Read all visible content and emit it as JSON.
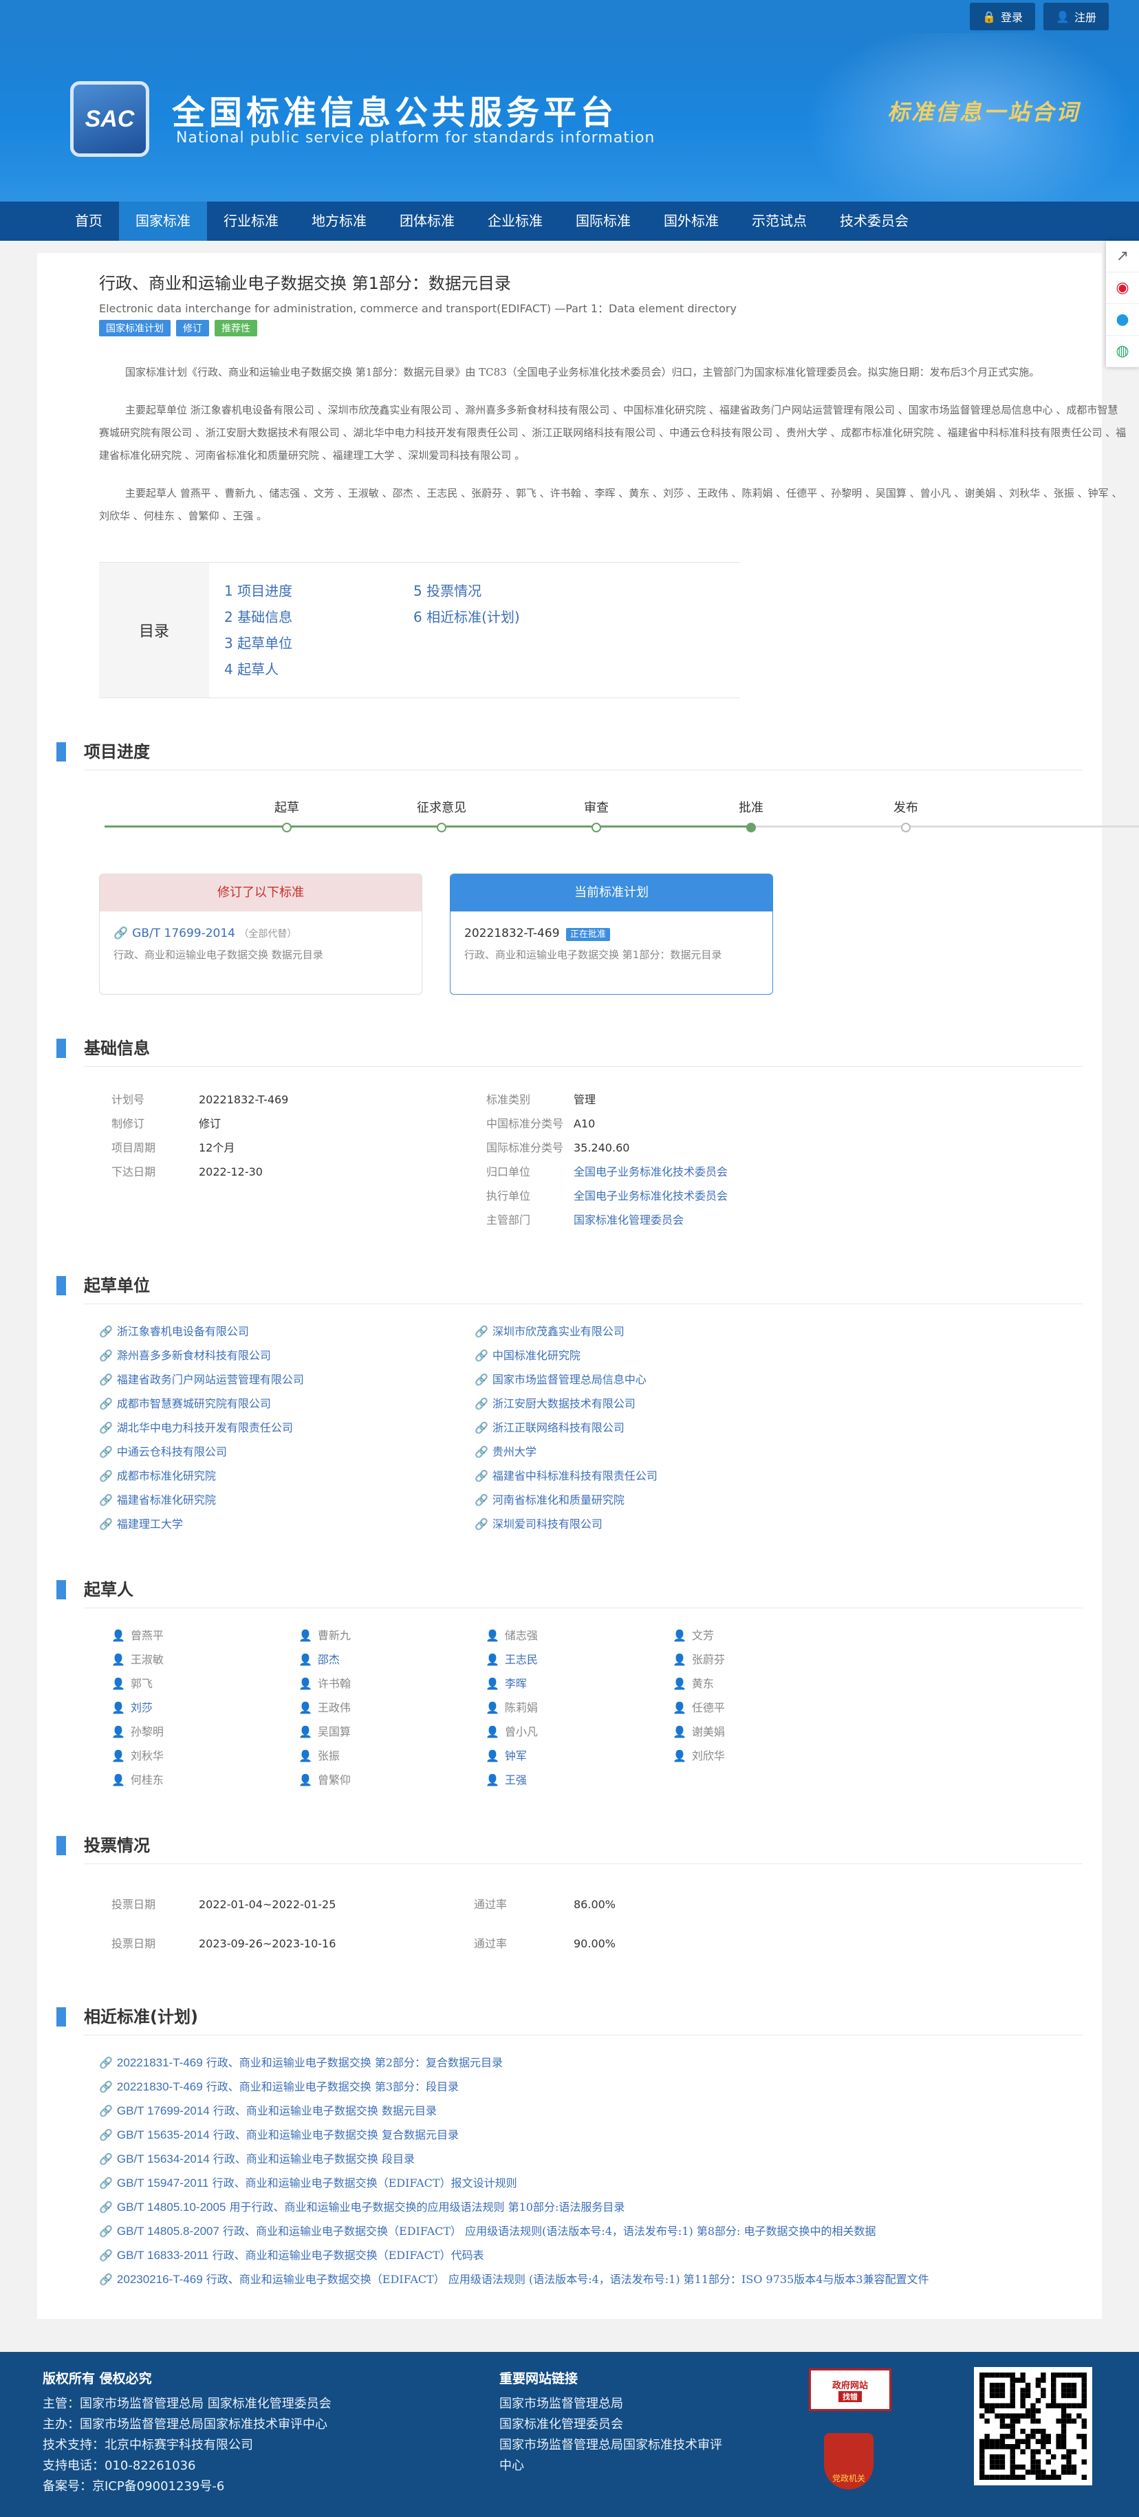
{
  "top": {
    "login": "登录",
    "register": "注册"
  },
  "header": {
    "logo_text": "SAC",
    "title_cn": "全国标准信息公共服务平台",
    "title_en": "National public service platform  for standards information",
    "slogan": "标准信息一站合词"
  },
  "nav": [
    "首页",
    "国家标准",
    "行业标准",
    "地方标准",
    "团体标准",
    "企业标准",
    "国际标准",
    "国外标准",
    "示范试点",
    "技术委员会"
  ],
  "standard": {
    "title": "行政、商业和运输业电子数据交换 第1部分：数据元目录",
    "title_en": "Electronic data interchange for administration, commerce and transport(EDIFACT) —Part 1：Data element directory",
    "tags": [
      {
        "label": "国家标准计划",
        "color": "#3c8ee0"
      },
      {
        "label": "修订",
        "color": "#3c8ee0"
      },
      {
        "label": "推荐性",
        "color": "#5cb85c"
      }
    ],
    "para1": "国家标准计划《行政、商业和运输业电子数据交换 第1部分：数据元目录》由 TC83（全国电子业务标准化技术委员会）归口，主管部门为国家标准化管理委员会。拟实施日期：发布后3个月正式实施。",
    "para2": "主要起草单位 浙江象睿机电设备有限公司 、深圳市欣茂鑫实业有限公司 、滁州喜多多新食材科技有限公司 、中国标准化研究院 、福建省政务门户网站运营管理有限公司 、国家市场监督管理总局信息中心 、成都市智慧赛城研究院有限公司 、浙江安厨大数据技术有限公司 、湖北华中电力科技开发有限责任公司 、浙江正联网络科技有限公司 、中通云仓科技有限公司 、贵州大学 、成都市标准化研究院 、福建省中科标准科技有限责任公司 、福建省标准化研究院 、河南省标准化和质量研究院 、福建理工大学 、深圳爱司科技有限公司 。",
    "para3": "主要起草人 曾燕平 、曹新九 、储志强 、文芳 、王淑敏 、邵杰 、王志民 、张蔚芬 、郭飞 、许书翰 、李晖 、黄东 、刘莎 、王政伟 、陈莉娟 、任德平 、孙黎明 、吴国算 、曾小凡 、谢美娟 、刘秋华 、张振 、钟军 、刘欣华 、何桂东 、曾繁仰 、王强 。"
  },
  "toc": {
    "label": "目录",
    "col1": [
      "1  项目进度",
      "2  基础信息",
      "3  起草单位",
      "4  起草人"
    ],
    "col2": [
      "5  投票情况",
      "6  相近标准(计划)"
    ]
  },
  "progress": {
    "title": "项目进度",
    "steps": [
      {
        "label": "起草",
        "state": "done"
      },
      {
        "label": "征求意见",
        "state": "done"
      },
      {
        "label": "审查",
        "state": "done"
      },
      {
        "label": "批准",
        "state": "current"
      },
      {
        "label": "发布",
        "state": "todo"
      }
    ],
    "card_left": {
      "header": "修订了以下标准",
      "code": "GB/T 17699-2014",
      "note": "（全部代替）",
      "name": "行政、商业和运输业电子数据交换 数据元目录"
    },
    "card_right": {
      "header": "当前标准计划",
      "code": "20221832-T-469",
      "badge": "正在批准",
      "name": "行政、商业和运输业电子数据交换 第1部分：数据元目录"
    }
  },
  "basic": {
    "title": "基础信息",
    "rows": [
      {
        "k1": "计划号",
        "v1": "20221832-T-469",
        "k2": "标准类别",
        "v2": "管理",
        "link": false
      },
      {
        "k1": "制修订",
        "v1": "修订",
        "k2": "中国标准分类号",
        "v2": "A10",
        "link": false
      },
      {
        "k1": "项目周期",
        "v1": "12个月",
        "k2": "国际标准分类号",
        "v2": "35.240.60",
        "link": false
      },
      {
        "k1": "下达日期",
        "v1": "2022-12-30",
        "k2": "归口单位",
        "v2": "全国电子业务标准化技术委员会",
        "link": true
      },
      {
        "k1": "",
        "v1": "",
        "k2": "执行单位",
        "v2": "全国电子业务标准化技术委员会",
        "link": true
      },
      {
        "k1": "",
        "v1": "",
        "k2": "主管部门",
        "v2": "国家标准化管理委员会",
        "link": true
      }
    ]
  },
  "units": {
    "title": "起草单位",
    "items": [
      "浙江象睿机电设备有限公司",
      "深圳市欣茂鑫实业有限公司",
      "滁州喜多多新食材科技有限公司",
      "中国标准化研究院",
      "福建省政务门户网站运营管理有限公司",
      "国家市场监督管理总局信息中心",
      "成都市智慧赛城研究院有限公司",
      "浙江安厨大数据技术有限公司",
      "湖北华中电力科技开发有限责任公司",
      "浙江正联网络科技有限公司",
      "中通云仓科技有限公司",
      "贵州大学",
      "成都市标准化研究院",
      "福建省中科标准科技有限责任公司",
      "福建省标准化研究院",
      "河南省标准化和质量研究院",
      "福建理工大学",
      "深圳爱司科技有限公司"
    ]
  },
  "people": {
    "title": "起草人",
    "items": [
      {
        "n": "曾燕平",
        "l": false
      },
      {
        "n": "曹新九",
        "l": false
      },
      {
        "n": "储志强",
        "l": false
      },
      {
        "n": "文芳",
        "l": false
      },
      {
        "n": "王淑敏",
        "l": false
      },
      {
        "n": "邵杰",
        "l": true
      },
      {
        "n": "王志民",
        "l": true
      },
      {
        "n": "张蔚芬",
        "l": false
      },
      {
        "n": "郭飞",
        "l": false
      },
      {
        "n": "许书翰",
        "l": false
      },
      {
        "n": "李晖",
        "l": true
      },
      {
        "n": "黄东",
        "l": false
      },
      {
        "n": "刘莎",
        "l": true
      },
      {
        "n": "王政伟",
        "l": false
      },
      {
        "n": "陈莉娟",
        "l": false
      },
      {
        "n": "任德平",
        "l": false
      },
      {
        "n": "孙黎明",
        "l": false
      },
      {
        "n": "吴国算",
        "l": false
      },
      {
        "n": "曾小凡",
        "l": false
      },
      {
        "n": "谢美娟",
        "l": false
      },
      {
        "n": "刘秋华",
        "l": false
      },
      {
        "n": "张振",
        "l": false
      },
      {
        "n": "钟军",
        "l": true
      },
      {
        "n": "刘欣华",
        "l": false
      },
      {
        "n": "何桂东",
        "l": false
      },
      {
        "n": "曾繁仰",
        "l": false
      },
      {
        "n": "王强",
        "l": true
      }
    ]
  },
  "votes": {
    "title": "投票情况",
    "rows": [
      {
        "k1": "投票日期",
        "v1": "2022-01-04~2022-01-25",
        "k2": "通过率",
        "v2": "86.00%"
      },
      {
        "k1": "投票日期",
        "v1": "2023-09-26~2023-10-16",
        "k2": "通过率",
        "v2": "90.00%"
      }
    ]
  },
  "related": {
    "title": "相近标准(计划)",
    "items": [
      {
        "code": "20221831-T-469",
        "name": "行政、商业和运输业电子数据交换 第2部分：复合数据元目录"
      },
      {
        "code": "20221830-T-469",
        "name": "行政、商业和运输业电子数据交换 第3部分：段目录"
      },
      {
        "code": "GB/T 17699-2014",
        "name": "行政、商业和运输业电子数据交换 数据元目录"
      },
      {
        "code": "GB/T 15635-2014",
        "name": "行政、商业和运输业电子数据交换 复合数据元目录"
      },
      {
        "code": "GB/T 15634-2014",
        "name": "行政、商业和运输业电子数据交换 段目录"
      },
      {
        "code": "GB/T 15947-2011",
        "name": "行政、商业和运输业电子数据交换（EDIFACT）报文设计规则"
      },
      {
        "code": "GB/T 14805.10-2005",
        "name": "用于行政、商业和运输业电子数据交换的应用级语法规则 第10部分:语法服务目录"
      },
      {
        "code": "GB/T 14805.8-2007",
        "name": "行政、商业和运输业电子数据交换（EDIFACT） 应用级语法规则(语法版本号:4，语法发布号:1) 第8部分: 电子数据交换中的相关数据"
      },
      {
        "code": "GB/T 16833-2011",
        "name": "行政、商业和运输业电子数据交换（EDIFACT）代码表"
      },
      {
        "code": "20230216-T-469",
        "name": "行政、商业和运输业电子数据交换（EDIFACT） 应用级语法规则 (语法版本号:4，语法发布号:1) 第11部分：ISO 9735版本4与版本3兼容配置文件"
      }
    ]
  },
  "footer": {
    "c1_title": "版权所有 侵权必究",
    "c1_lines": [
      "主管：国家市场监督管理总局 国家标准化管理委员会",
      "主办：国家市场监督管理总局国家标准技术审评中心",
      "技术支持：北京中标赛宇科技有限公司",
      "支持电话：010-82261036",
      "备案号：京ICP备09001239号-6"
    ],
    "c2_title": "重要网站链接",
    "c2_lines": [
      "国家市场监督管理总局",
      "国家标准化管理委员会",
      "国家市场监督管理总局国家标准技术审评",
      "中心"
    ],
    "gov_label": "政府网站",
    "gov_sub": "找错",
    "police_label": "党政机关"
  }
}
